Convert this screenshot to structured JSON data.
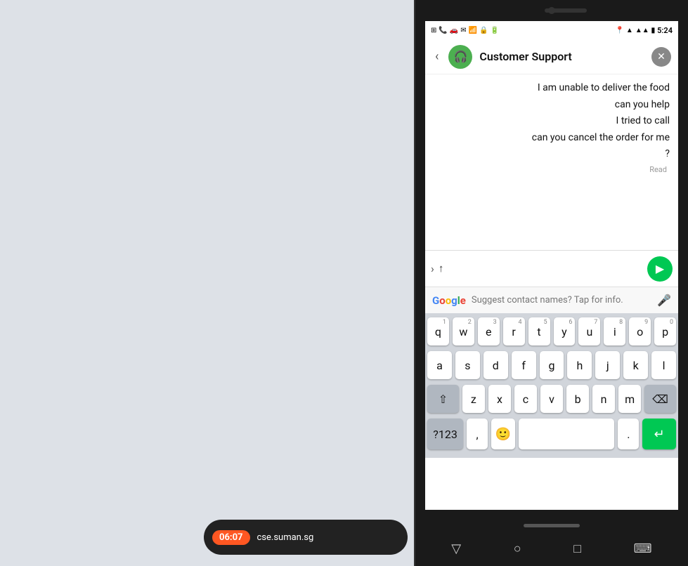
{
  "desktop": {
    "background": "#dde1e7"
  },
  "notification": {
    "time": "06:07",
    "domain": "cse.suman.sg"
  },
  "phone": {
    "status_bar": {
      "time": "5:24",
      "icons": [
        "signal",
        "wifi",
        "battery"
      ]
    },
    "header": {
      "back_label": "‹",
      "avatar_icon": "🎧",
      "title": "Customer Support",
      "close_icon": "✕"
    },
    "messages": [
      {
        "text": "I am unable to deliver the food"
      },
      {
        "text": "can you help"
      },
      {
        "text": "I tried to call"
      },
      {
        "text": "can you cancel the order for me"
      },
      {
        "text": "?"
      }
    ],
    "read_status": "Read",
    "input": {
      "placeholder": "",
      "current_value": "↑",
      "cursor": "|"
    },
    "send_icon": "▶",
    "suggest_bar": {
      "text": "Suggest contact names? Tap for info."
    },
    "keyboard": {
      "row1": [
        "q",
        "w",
        "e",
        "r",
        "t",
        "y",
        "u",
        "i",
        "o",
        "p"
      ],
      "row1_nums": [
        "1",
        "2",
        "3",
        "4",
        "5",
        "6",
        "7",
        "8",
        "9",
        "0"
      ],
      "row2": [
        "a",
        "s",
        "d",
        "f",
        "g",
        "h",
        "j",
        "k",
        "l"
      ],
      "row3": [
        "z",
        "x",
        "c",
        "v",
        "b",
        "n",
        "m"
      ],
      "bottom": [
        "?123",
        ",",
        "😊",
        "",
        ".",
        "↵"
      ],
      "special": {
        "shift": "⇧",
        "delete": "⌫"
      }
    },
    "nav": {
      "back": "▽",
      "home": "○",
      "recents": "□",
      "keyboard": "⌨"
    }
  }
}
